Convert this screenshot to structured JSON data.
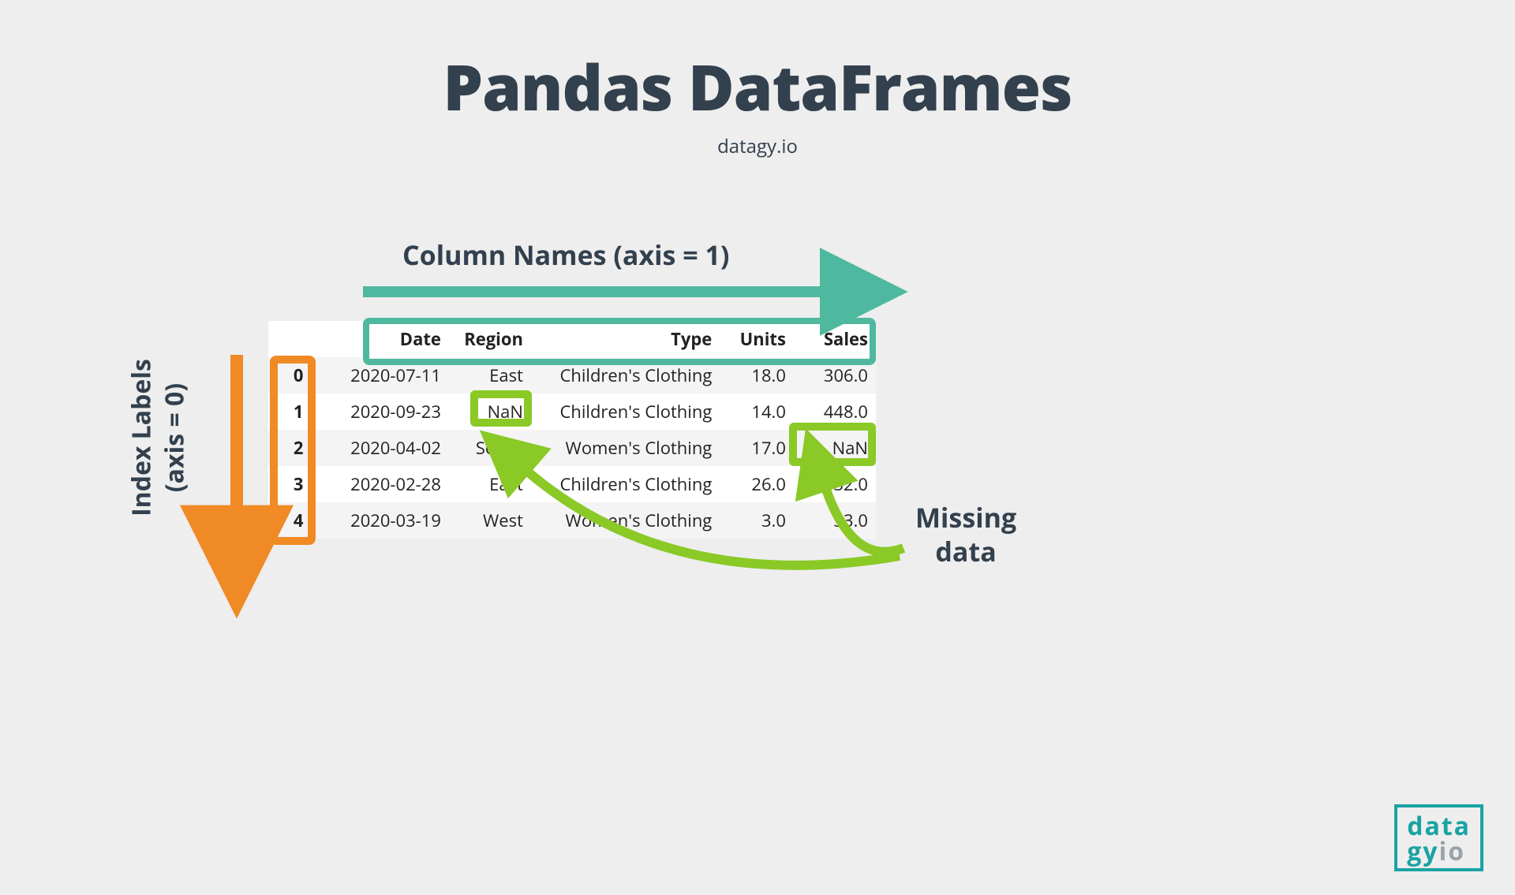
{
  "title": "Pandas DataFrames",
  "subtitle": "datagy.io",
  "labels": {
    "columns": "Column Names (axis = 1)",
    "index_main": "Index Labels",
    "index_axis": "(axis = 0)",
    "missing1": "Missing",
    "missing2": "data"
  },
  "table": {
    "headers": [
      "",
      "Date",
      "Region",
      "Type",
      "Units",
      "Sales"
    ],
    "rows": [
      {
        "idx": "0",
        "date": "2020-07-11",
        "region": "East",
        "type": "Children's Clothing",
        "units": "18.0",
        "sales": "306.0"
      },
      {
        "idx": "1",
        "date": "2020-09-23",
        "region": "NaN",
        "type": "Children's Clothing",
        "units": "14.0",
        "sales": "448.0"
      },
      {
        "idx": "2",
        "date": "2020-04-02",
        "region": "South",
        "type": "Women's Clothing",
        "units": "17.0",
        "sales": "NaN"
      },
      {
        "idx": "3",
        "date": "2020-02-28",
        "region": "East",
        "type": "Children's Clothing",
        "units": "26.0",
        "sales": "832.0"
      },
      {
        "idx": "4",
        "date": "2020-03-19",
        "region": "West",
        "type": "Women's Clothing",
        "units": "3.0",
        "sales": "33.0"
      }
    ]
  },
  "logo": {
    "line1": "data",
    "line2a": "gy",
    "line2b": "io"
  }
}
